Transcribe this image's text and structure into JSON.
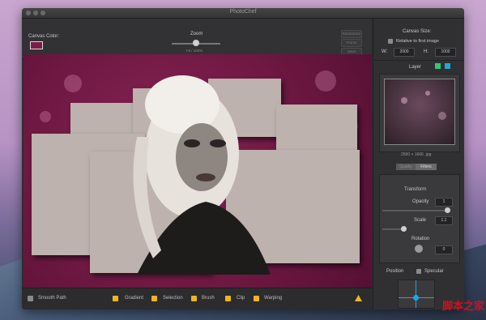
{
  "window": {
    "title": "PhotoChef"
  },
  "toolbar": {
    "canvas_color_label": "Canvas Color:",
    "zoom_label": "Zoom",
    "zoom_sub": "Fit / 100%",
    "buttons": [
      "Randomize",
      "Frame",
      "Save"
    ]
  },
  "bottombar": {
    "smooth_path_label": "Smooth Path",
    "toggles": [
      "Gradient",
      "Selection",
      "Brush",
      "Clip",
      "Warping"
    ],
    "warning_icon": "warning-icon"
  },
  "sidebar": {
    "canvas_size_label": "Canvas Size:",
    "relative_label": "Relative to first image",
    "w_label": "W:",
    "w_value": "2000",
    "h_label": "H:",
    "h_value": "1000",
    "layer_label": "Layer",
    "image_info": "2500 × 1666 .jpg",
    "seg_left": "Quality",
    "seg_right": "Filters",
    "transform_label": "Transform",
    "opacity_label": "Opacity",
    "opacity_value": "1",
    "scale_label": "Scale",
    "scale_value": "1.1",
    "rotation_label": "Rotation",
    "rotation_value": "0",
    "position_label": "Position",
    "specular_label": "Specular"
  },
  "watermark": {
    "chinese": "脚本之家",
    "url": "www.jb51.net"
  },
  "colors": {
    "canvas": "#7c1b4a",
    "accent": "#1fa6e0",
    "toggle": "#f0b323",
    "layer_green": "#2ecc71",
    "layer_blue": "#1fa6e0"
  }
}
